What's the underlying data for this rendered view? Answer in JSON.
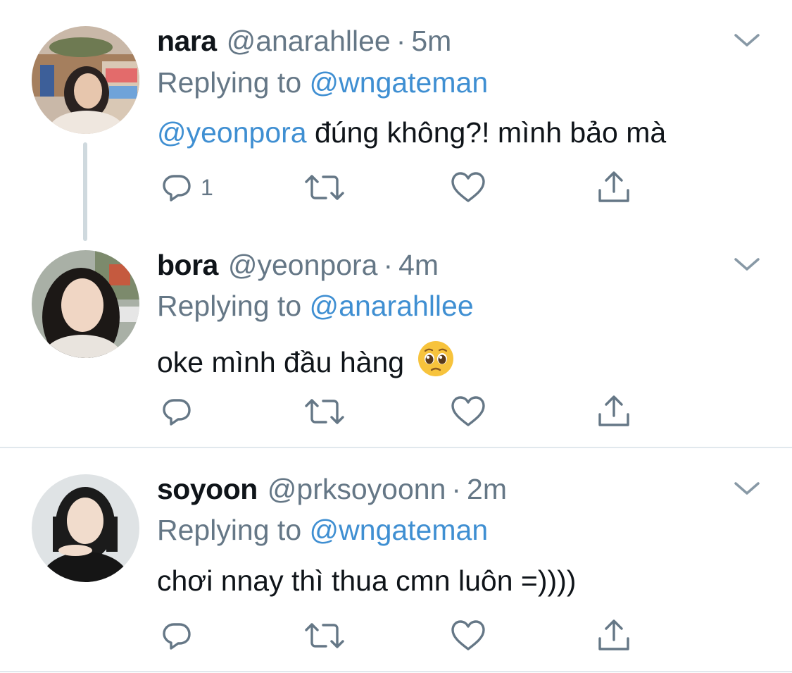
{
  "tweets": [
    {
      "display_name": "nara",
      "handle": "@anarahllee",
      "dot": "·",
      "time": "5m",
      "replying_prefix": "Replying to",
      "replying_to": "@wngateman",
      "body_mention": "@yeonpora",
      "body_text": " đúng không?! mình bảo mà",
      "reply_count": "1"
    },
    {
      "display_name": "bora",
      "handle": "@yeonpora",
      "dot": "·",
      "time": "4m",
      "replying_prefix": "Replying to",
      "replying_to": "@anarahllee",
      "body_text": "oke mình đầu hàng",
      "body_emoji": "pleading-face-emoji",
      "reply_count": ""
    },
    {
      "display_name": "soyoon",
      "handle": "@prksoyoonn",
      "dot": "·",
      "time": "2m",
      "replying_prefix": "Replying to",
      "replying_to": "@wngateman",
      "body_text": "chơi nnay thì thua cmn luôn =))))",
      "reply_count": ""
    }
  ],
  "icons": {
    "reply": "reply-icon",
    "retweet": "retweet-icon",
    "like": "like-icon",
    "share": "share-icon",
    "more": "chevron-down-icon"
  },
  "colors": {
    "link": "#3f8fd2",
    "secondary_text": "#657786",
    "primary_text": "#0f1419",
    "thread_line": "#cfd9de",
    "divider": "#e1e8ed"
  }
}
